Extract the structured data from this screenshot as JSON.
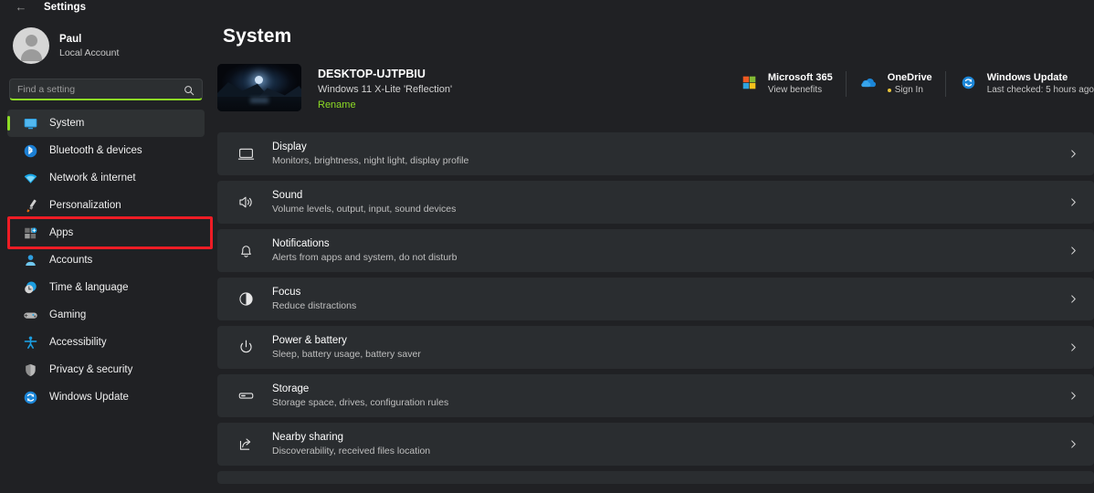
{
  "window": {
    "back_icon": "back-arrow-icon",
    "title": "Settings"
  },
  "sidebar": {
    "account": {
      "name": "Paul",
      "subtitle": "Local Account",
      "avatar_icon": "user-avatar-icon"
    },
    "search": {
      "placeholder": "Find a setting",
      "value": "",
      "icon": "search-icon",
      "underline_color": "#8ddc25"
    },
    "items": [
      {
        "label": "System",
        "icon": "monitor-icon",
        "selected": true,
        "highlighted": false
      },
      {
        "label": "Bluetooth & devices",
        "icon": "bluetooth-icon",
        "selected": false,
        "highlighted": false
      },
      {
        "label": "Network & internet",
        "icon": "wifi-icon",
        "selected": false,
        "highlighted": false
      },
      {
        "label": "Personalization",
        "icon": "paintbrush-icon",
        "selected": false,
        "highlighted": false
      },
      {
        "label": "Apps",
        "icon": "apps-grid-icon",
        "selected": false,
        "highlighted": true
      },
      {
        "label": "Accounts",
        "icon": "person-icon",
        "selected": false,
        "highlighted": false
      },
      {
        "label": "Time & language",
        "icon": "clock-icon",
        "selected": false,
        "highlighted": false
      },
      {
        "label": "Gaming",
        "icon": "gamepad-icon",
        "selected": false,
        "highlighted": false
      },
      {
        "label": "Accessibility",
        "icon": "accessibility-icon",
        "selected": false,
        "highlighted": false
      },
      {
        "label": "Privacy & security",
        "icon": "shield-icon",
        "selected": false,
        "highlighted": false
      },
      {
        "label": "Windows Update",
        "icon": "update-refresh-icon",
        "selected": false,
        "highlighted": false
      }
    ],
    "highlight_color": "#ee1c25",
    "accent_color": "#8ddc25"
  },
  "main": {
    "title": "System",
    "device": {
      "thumbnail_icon": "desktop-wallpaper-thumbnail",
      "name": "DESKTOP-UJTPBIU",
      "os": "Windows 11 X-Lite 'Reflection'",
      "rename_label": "Rename",
      "rename_color": "#8ddc25"
    },
    "widgets": [
      {
        "title": "Microsoft 365",
        "subtitle": "View benefits",
        "icon": "microsoft-365-icon",
        "has_dot": false
      },
      {
        "title": "OneDrive",
        "subtitle": "Sign In",
        "icon": "onedrive-cloud-icon",
        "has_dot": true
      },
      {
        "title": "Windows Update",
        "subtitle": "Last checked: 5 hours ago",
        "icon": "update-refresh-icon",
        "has_dot": false
      }
    ],
    "rows": [
      {
        "title": "Display",
        "subtitle": "Monitors, brightness, night light, display profile",
        "icon": "monitor-outline-icon"
      },
      {
        "title": "Sound",
        "subtitle": "Volume levels, output, input, sound devices",
        "icon": "speaker-icon"
      },
      {
        "title": "Notifications",
        "subtitle": "Alerts from apps and system, do not disturb",
        "icon": "bell-icon"
      },
      {
        "title": "Focus",
        "subtitle": "Reduce distractions",
        "icon": "focus-moon-icon"
      },
      {
        "title": "Power & battery",
        "subtitle": "Sleep, battery usage, battery saver",
        "icon": "power-icon"
      },
      {
        "title": "Storage",
        "subtitle": "Storage space, drives, configuration rules",
        "icon": "storage-drive-icon"
      },
      {
        "title": "Nearby sharing",
        "subtitle": "Discoverability, received files location",
        "icon": "share-icon"
      }
    ],
    "chevron_icon": "chevron-right-icon"
  },
  "colors": {
    "background": "#202124",
    "row_background": "#2a2d30",
    "accent_green": "#8ddc25",
    "highlight_red": "#ee1c25"
  }
}
